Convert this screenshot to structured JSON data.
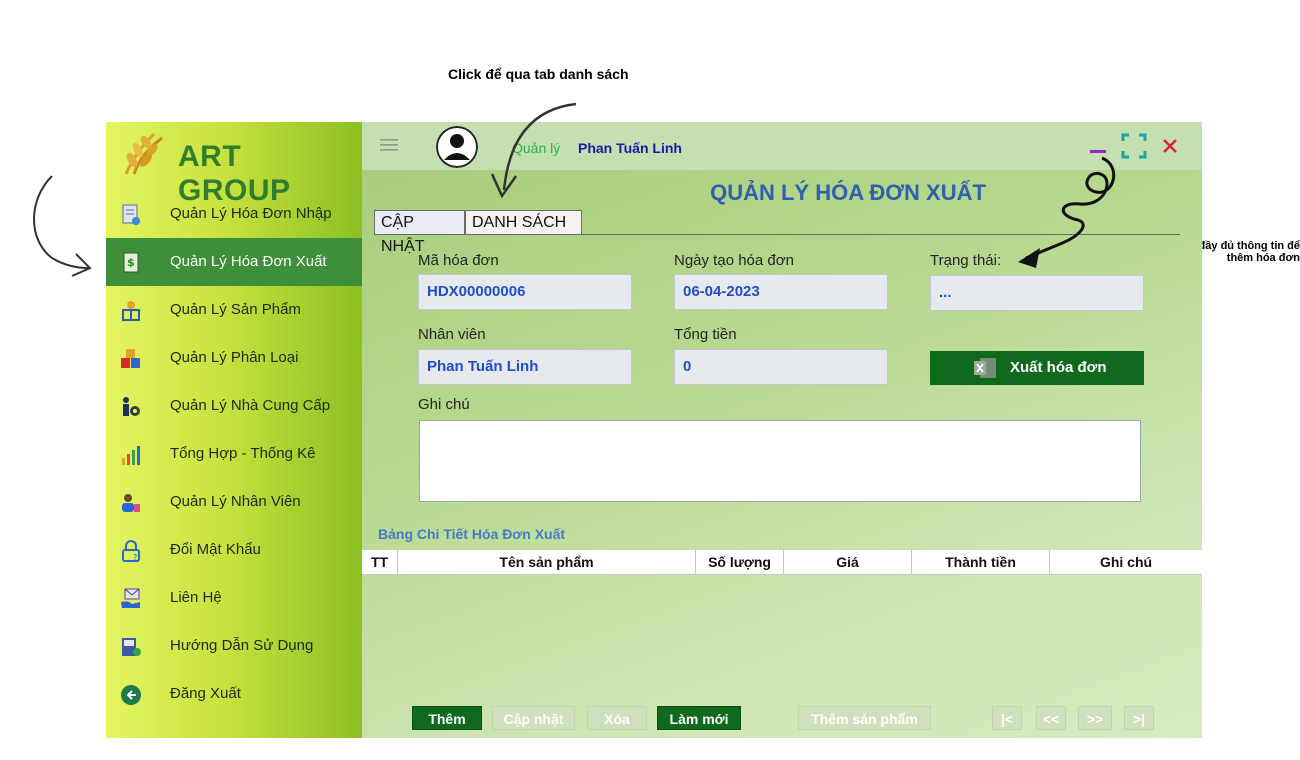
{
  "annotations": {
    "top_note": "Click để qua tab danh sách",
    "right_note_line1": "Nhập đầy đủ thông tin để",
    "right_note_line2": "thêm hóa đơn"
  },
  "brand": {
    "name": "ART GROUP"
  },
  "sidebar": {
    "items": [
      {
        "label": "Quản Lý Hóa Đơn Nhập",
        "icon": "invoice-import-icon"
      },
      {
        "label": "Quản Lý Hóa Đơn Xuất",
        "icon": "invoice-export-icon",
        "active": true
      },
      {
        "label": "Quản Lý Sản Phẩm",
        "icon": "product-icon"
      },
      {
        "label": "Quản Lý Phân Loại",
        "icon": "category-icon"
      },
      {
        "label": "Quản Lý Nhà Cung Cấp",
        "icon": "supplier-icon"
      },
      {
        "label": "Tổng Hợp - Thống Kê",
        "icon": "statistics-icon"
      },
      {
        "label": "Quản Lý Nhân Viên",
        "icon": "employee-icon"
      },
      {
        "label": "Đổi Mật Khẩu",
        "icon": "lock-icon"
      },
      {
        "label": "Liên Hệ",
        "icon": "contact-icon"
      },
      {
        "label": "Hướng Dẫn Sử Dụng",
        "icon": "guide-icon"
      },
      {
        "label": "Đăng Xuất",
        "icon": "logout-icon"
      }
    ]
  },
  "header": {
    "role": "Quản lý",
    "username": "Phan Tuấn Linh",
    "minimize_icon": "minimize-icon",
    "maximize_icon": "maximize-icon",
    "close_icon": "close-icon"
  },
  "page": {
    "title": "QUẢN LÝ HÓA ĐƠN XUẤT",
    "tabs": [
      "CẬP NHẬT",
      "DANH SÁCH"
    ]
  },
  "form": {
    "invoice_id_label": "Mã hóa đơn",
    "invoice_id": "HDX00000006",
    "created_date_label": "Ngày tạo hóa đơn",
    "created_date": "06-04-2023",
    "status_label": "Trạng thái:",
    "status": "...",
    "employee_label": "Nhân viên",
    "employee": "Phan Tuấn Linh",
    "total_label": "Tổng tiền",
    "total": "0",
    "export_button": "Xuất hóa đơn",
    "notes_label": "Ghi chú",
    "notes": ""
  },
  "details": {
    "title": "Bảng Chi Tiết Hóa Đơn Xuất",
    "columns": [
      "TT",
      "Tên sản phẩm",
      "Số lượng",
      "Giá",
      "Thành tiền",
      "Ghi chú"
    ]
  },
  "buttons": {
    "add": "Thêm",
    "update": "Cập nhật",
    "delete": "Xóa",
    "refresh": "Làm mới",
    "add_product": "Thêm sản phẩm",
    "first": "|<",
    "prev": "<<",
    "next": ">>",
    "last": ">|"
  },
  "colors": {
    "accent_green": "#0f6a1e",
    "title_blue": "#2e5fb0",
    "sidebar_active": "#3d8f3a"
  }
}
